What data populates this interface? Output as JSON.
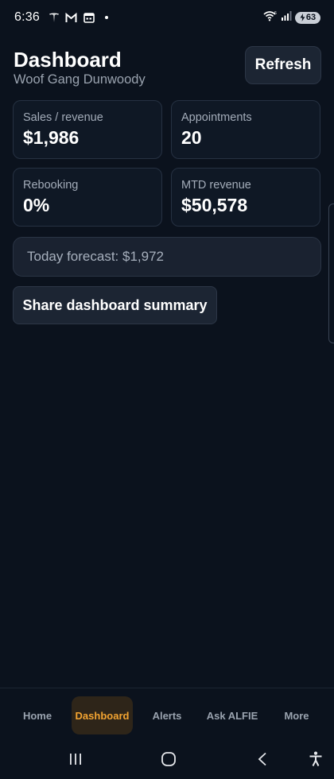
{
  "status_bar": {
    "time": "6:36",
    "battery": "63",
    "notification_icons": [
      "tesla-icon",
      "gmail-icon",
      "calendar-icon",
      "dot-icon"
    ],
    "system_icons": [
      "wifi-icon",
      "signal-icon",
      "battery-icon"
    ]
  },
  "header": {
    "title": "Dashboard",
    "subtitle": "Woof Gang Dunwoody",
    "refresh_label": "Refresh"
  },
  "stats": [
    {
      "label": "Sales / revenue",
      "value": "$1,986"
    },
    {
      "label": "Appointments",
      "value": "20"
    },
    {
      "label": "Rebooking",
      "value": "0%"
    },
    {
      "label": "MTD revenue",
      "value": "$50,578"
    }
  ],
  "forecast": {
    "text": "Today forecast: $1,972"
  },
  "share_label": "Share dashboard summary",
  "bottom_nav": {
    "items": [
      {
        "label": "Home",
        "active": false
      },
      {
        "label": "Dashboard",
        "active": true
      },
      {
        "label": "Alerts",
        "active": false
      },
      {
        "label": "Ask ALFIE",
        "active": false
      },
      {
        "label": "More",
        "active": false
      }
    ]
  },
  "system_nav": [
    "recents-icon",
    "home-icon",
    "back-icon",
    "accessibility-icon"
  ],
  "colors": {
    "background": "#0b121d",
    "card": "#0f1825",
    "accent": "#f3a431",
    "active_tab_bg": "#2e2519",
    "muted_text": "#9aa3af"
  }
}
